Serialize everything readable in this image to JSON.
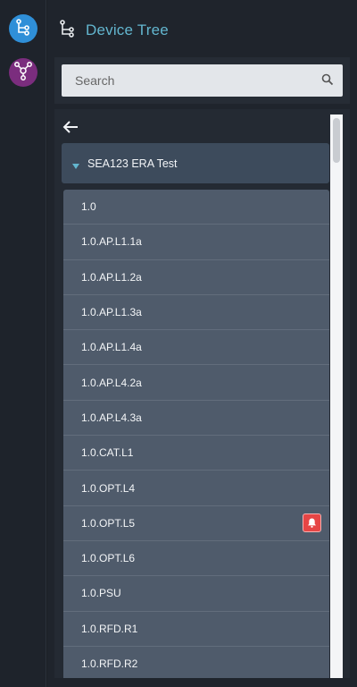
{
  "header": {
    "title": "Device Tree"
  },
  "search": {
    "placeholder": "Search"
  },
  "group": {
    "name": "SEA123 ERA Test"
  },
  "items": [
    {
      "label": "1.0",
      "alert": false
    },
    {
      "label": "1.0.AP.L1.1a",
      "alert": false
    },
    {
      "label": "1.0.AP.L1.2a",
      "alert": false
    },
    {
      "label": "1.0.AP.L1.3a",
      "alert": false
    },
    {
      "label": "1.0.AP.L1.4a",
      "alert": false
    },
    {
      "label": "1.0.AP.L4.2a",
      "alert": false
    },
    {
      "label": "1.0.AP.L4.3a",
      "alert": false
    },
    {
      "label": "1.0.CAT.L1",
      "alert": false
    },
    {
      "label": "1.0.OPT.L4",
      "alert": false
    },
    {
      "label": "1.0.OPT.L5",
      "alert": true
    },
    {
      "label": "1.0.OPT.L6",
      "alert": false
    },
    {
      "label": "1.0.PSU",
      "alert": false
    },
    {
      "label": "1.0.RFD.R1",
      "alert": false
    },
    {
      "label": "1.0.RFD.R2",
      "alert": false
    }
  ],
  "icons": {
    "rail_tree": "device-tree-icon",
    "rail_topology": "topology-icon",
    "header": "device-tree-icon",
    "search": "search-icon",
    "back": "arrow-left-icon",
    "caret": "caret-down-icon",
    "alert": "bell-icon"
  },
  "colors": {
    "accent": "#63b6cf",
    "rail_tree": "#2f8fd8",
    "rail_topology": "#7b2d7e",
    "alert": "#e64545"
  }
}
